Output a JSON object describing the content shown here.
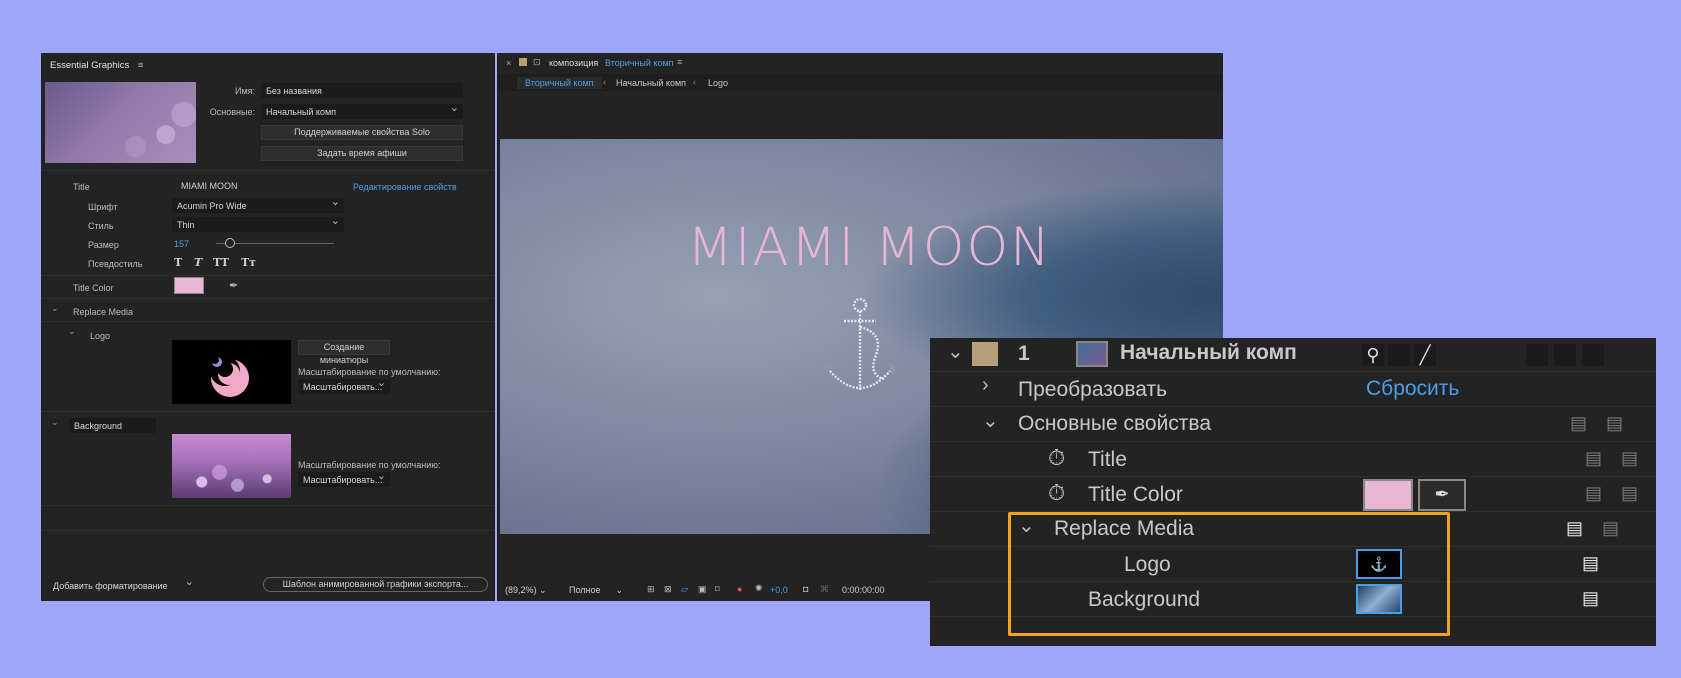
{
  "essential_graphics": {
    "title": "Essential Graphics",
    "name_label": "Имя:",
    "name_value": "Без названия",
    "master_label": "Основные:",
    "master_value": "Начальный комп",
    "solo_button": "Поддерживаемые свойства Solo",
    "poster_button": "Задать время афиши",
    "edit_props_link": "Редактирование свойств",
    "title_row": {
      "label": "Title",
      "value": "MIAMI MOON"
    },
    "font_label": "Шрифт",
    "font_value": "Acumin Pro Wide",
    "style_label": "Стиль",
    "style_value": "Thin",
    "size_label": "Размер",
    "size_value": "157",
    "faux_label": "Псевдостиль",
    "faux_styles": [
      "T",
      "T",
      "TT",
      "Tт"
    ],
    "title_color_label": "Title Color",
    "replace_media_label": "Replace Media",
    "logo_label": "Logo",
    "create_thumb_button": "Создание миниатюры",
    "scale_default_label": "Масштабирование по умолчанию:",
    "scale_value": "Масштабировать...",
    "background_label": "Background",
    "add_format": "Добавить форматирование",
    "export_button": "Шаблон анимированной графики экспорта..."
  },
  "monitor": {
    "tab_label": "композиция",
    "tab_comp": "Вторичный комп",
    "crumbs": [
      "Вторичный комп",
      "Начальный комп",
      "Logo"
    ],
    "video_title": "MIAMI MOON",
    "zoom": "(89,2%)",
    "quality": "Полное",
    "exposure": "+0,0",
    "timecode": "0:00:00:00"
  },
  "effects": {
    "layer_num": "1",
    "layer_name": "Начальный комп",
    "transform": "Преобразовать",
    "reset": "Сбросить",
    "essential": "Основные свойства",
    "title": "Title",
    "title_color": "Title Color",
    "replace_media": "Replace Media",
    "logo": "Logo",
    "background": "Background"
  },
  "colors": {
    "title_pink": "#e9b6d4",
    "accent_blue": "#4a9fe8",
    "highlight_orange": "#f2a31c",
    "page_bg": "#9ea6fb"
  }
}
